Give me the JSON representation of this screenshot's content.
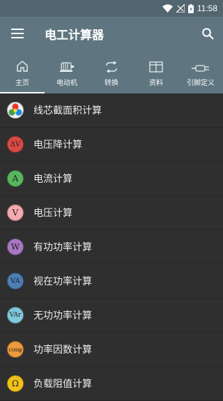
{
  "status": {
    "time": "11:58"
  },
  "app": {
    "title": "电工计算器"
  },
  "tabs": [
    {
      "label": "主页",
      "icon": "home-icon"
    },
    {
      "label": "电动机",
      "icon": "motor-icon"
    },
    {
      "label": "转换",
      "icon": "convert-icon"
    },
    {
      "label": "资料",
      "icon": "book-icon"
    },
    {
      "label": "引脚定义",
      "icon": "connector-icon"
    }
  ],
  "items": [
    {
      "label": "线芯截面积计算",
      "symbol": "",
      "icon": "cross-section-icon",
      "color": "#e04040"
    },
    {
      "label": "电压降计算",
      "symbol": "ΔV",
      "icon": "voltage-drop-icon",
      "color": "#d94a44"
    },
    {
      "label": "电流计算",
      "symbol": "A",
      "icon": "current-icon",
      "color": "#57b65e"
    },
    {
      "label": "电压计算",
      "symbol": "V",
      "icon": "voltage-icon",
      "color": "#f4a9ae"
    },
    {
      "label": "有功功率计算",
      "symbol": "W",
      "icon": "active-power-icon",
      "color": "#a978c2"
    },
    {
      "label": "视在功率计算",
      "symbol": "VA",
      "icon": "apparent-power-icon",
      "color": "#4d7fb6"
    },
    {
      "label": "无功功率计算",
      "symbol": "VAr",
      "icon": "reactive-power-icon",
      "color": "#7fc8da"
    },
    {
      "label": "功率因数计算",
      "symbol": "cosφ",
      "icon": "power-factor-icon",
      "color": "#ef9a3c"
    },
    {
      "label": "负载阻值计算",
      "symbol": "Ω",
      "icon": "resistance-icon",
      "color": "#f2c21b"
    }
  ]
}
